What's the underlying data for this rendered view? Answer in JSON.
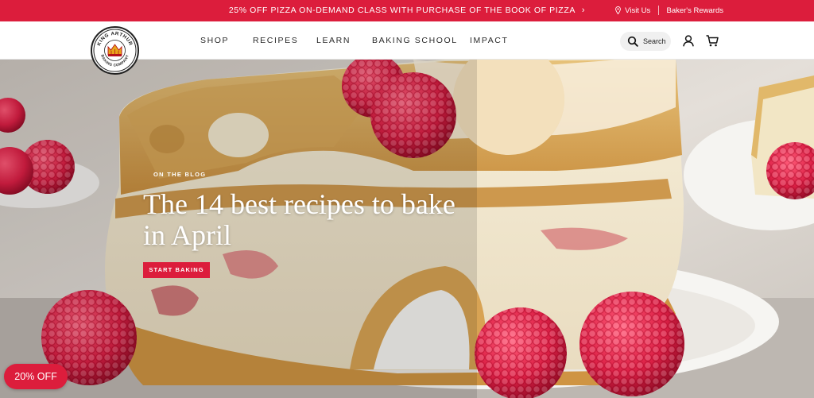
{
  "promo": {
    "text": "25% OFF PIZZA ON-DEMAND CLASS WITH PURCHASE OF THE BOOK OF PIZZA",
    "visit_us": "Visit Us",
    "rewards": "Baker's Rewards",
    "chevron_icon": "chevron-right-icon",
    "pin_icon": "map-pin-icon"
  },
  "logo": {
    "arc_top": "KING ARTHUR",
    "arc_bottom": "BAKING COMPANY"
  },
  "nav": {
    "items": [
      "SHOP",
      "RECIPES",
      "LEARN",
      "BAKING SCHOOL",
      "IMPACT"
    ],
    "search_label": "Search",
    "search_icon": "search-icon",
    "account_icon": "user-icon",
    "cart_icon": "cart-icon"
  },
  "hero": {
    "eyebrow": "ON THE BLOG",
    "headline": "The 14 best recipes to bake in April",
    "cta": "START BAKING"
  },
  "discount_tab": "20% OFF",
  "colors": {
    "brand_red": "#dc1d3c",
    "text_dark": "#2a2a2a"
  }
}
